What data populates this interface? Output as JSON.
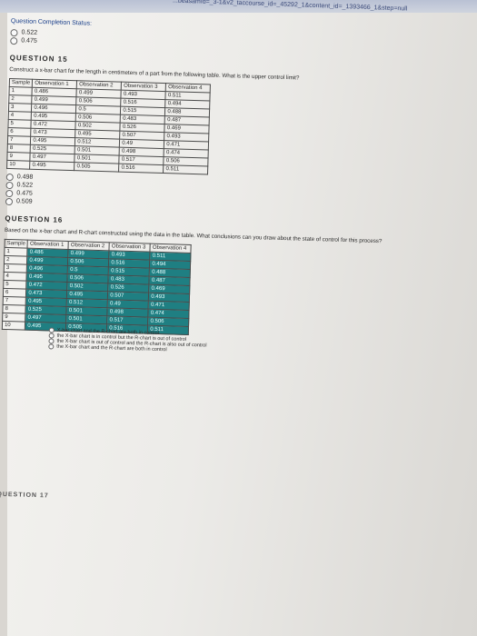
{
  "browser": {
    "url": "...beasamId=_3-1&v2_taccourse_id=_45292_1&content_id=_1393466_1&step=null"
  },
  "status_link": "Question Completion Status:",
  "prev_options": [
    "0.522",
    "0.475"
  ],
  "q15": {
    "heading": "QUESTION 15",
    "text": "Construct a x-bar chart for the length in centimeters of a part from the following table. What is the upper control limit?",
    "headers": [
      "Sample",
      "Observation 1",
      "Observation 2",
      "Observation 3",
      "Observation 4"
    ],
    "rows": [
      [
        "1",
        "0.486",
        "0.499",
        "0.493",
        "0.511"
      ],
      [
        "2",
        "0.499",
        "0.506",
        "0.516",
        "0.494"
      ],
      [
        "3",
        "0.496",
        "0.5",
        "0.515",
        "0.488"
      ],
      [
        "4",
        "0.495",
        "0.506",
        "0.483",
        "0.487"
      ],
      [
        "5",
        "0.472",
        "0.502",
        "0.526",
        "0.469"
      ],
      [
        "6",
        "0.473",
        "0.495",
        "0.507",
        "0.493"
      ],
      [
        "7",
        "0.495",
        "0.512",
        "0.49",
        "0.471"
      ],
      [
        "8",
        "0.525",
        "0.501",
        "0.498",
        "0.474"
      ],
      [
        "9",
        "0.497",
        "0.501",
        "0.517",
        "0.506"
      ],
      [
        "10",
        "0.495",
        "0.505",
        "0.516",
        "0.511"
      ]
    ],
    "options": [
      "0.498",
      "0.522",
      "0.475",
      "0.509"
    ]
  },
  "q16": {
    "heading": "QUESTION 16",
    "text": "Based on the x-bar chart and R-chart constructed using the data in the table. What conclusions can you draw about the state of control for this process?",
    "headers": [
      "Sample",
      "Observation 1",
      "Observation 2",
      "Observation 3",
      "Observation 4"
    ],
    "rows": [
      [
        "1",
        "0.486",
        "0.499",
        "0.493",
        "0.511"
      ],
      [
        "2",
        "0.499",
        "0.506",
        "0.516",
        "0.494"
      ],
      [
        "3",
        "0.496",
        "0.5",
        "0.515",
        "0.488"
      ],
      [
        "4",
        "0.495",
        "0.506",
        "0.483",
        "0.487"
      ],
      [
        "5",
        "0.472",
        "0.502",
        "0.526",
        "0.469"
      ],
      [
        "6",
        "0.473",
        "0.495",
        "0.507",
        "0.493"
      ],
      [
        "7",
        "0.495",
        "0.512",
        "0.49",
        "0.471"
      ],
      [
        "8",
        "0.525",
        "0.501",
        "0.498",
        "0.474"
      ],
      [
        "9",
        "0.497",
        "0.501",
        "0.517",
        "0.506"
      ],
      [
        "10",
        "0.495",
        "0.505",
        "0.516",
        "0.511"
      ]
    ],
    "options": [
      "X-bar chart and the R-chart are both in control",
      "the X-bar chart is in control but the R-chart is out of control",
      "the X-bar chart is out of control and the R-chart is also out of control",
      "the X-bar chart and the R-chart are both in control"
    ]
  },
  "q17": {
    "heading": "QUESTION 17"
  }
}
